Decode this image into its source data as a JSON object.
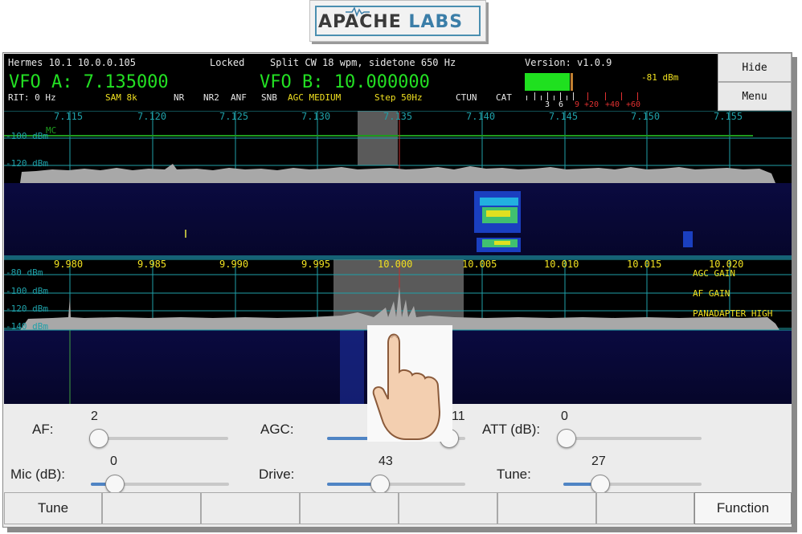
{
  "logo": {
    "text": "APACHE",
    "labs": "LABS"
  },
  "status": {
    "radio": "Hermes 10.1 10.0.0.105",
    "lock": "Locked",
    "mode": "Split CW 18 wpm, sidetone 650 Hz",
    "version": "Version: v1.0.9"
  },
  "vfo": {
    "a": "VFO A: 7.135000",
    "b": "VFO B: 10.000000"
  },
  "settings": {
    "rit": "RIT: 0 Hz",
    "mode": "SAM 8k",
    "nr": "NR",
    "nr2": "NR2",
    "anf": "ANF",
    "snb": "SNB",
    "agc": "AGC MEDIUM",
    "step": "Step 50Hz",
    "ctun": "CTUN",
    "cat": "CAT"
  },
  "meter": {
    "level_dbm": "-81 dBm",
    "scale_white": [
      "3",
      "6"
    ],
    "scale_red": [
      "9",
      "+20",
      "+40",
      "+60"
    ]
  },
  "side_buttons": {
    "hide": "Hide",
    "menu": "Menu"
  },
  "pan_a": {
    "freqs": [
      "7.115",
      "7.120",
      "7.125",
      "7.130",
      "7.135",
      "7.140",
      "7.145",
      "7.150",
      "7.155"
    ],
    "db_labels": [
      "-100 dBm",
      "-120 dBm"
    ],
    "marker": "MC"
  },
  "pan_b": {
    "freqs": [
      "9.980",
      "9.985",
      "9.990",
      "9.995",
      "10.000",
      "10.005",
      "10.010",
      "10.015",
      "10.020"
    ],
    "db_labels": [
      "-80 dBm",
      "-100 dBm",
      "-120 dBm",
      "-140 dBm"
    ],
    "overlay": [
      "AGC GAIN",
      "AF GAIN",
      "PANADAPTER HIGH"
    ]
  },
  "controls": {
    "af": {
      "label": "AF:",
      "value": "2",
      "fraction": 0.02
    },
    "agc": {
      "label": "AGC:",
      "value": "11",
      "fraction": 0.9
    },
    "att": {
      "label": "ATT (dB):",
      "value": "0",
      "fraction": 0.0
    },
    "mic": {
      "label": "Mic (dB):",
      "value": "0",
      "fraction": 0.16
    },
    "drive": {
      "label": "Drive:",
      "value": "43",
      "fraction": 0.43
    },
    "tune": {
      "label": "Tune:",
      "value": "27",
      "fraction": 0.27
    }
  },
  "bottom_buttons": [
    "Tune",
    "",
    "",
    "",
    "",
    "",
    "",
    "Function"
  ],
  "colors": {
    "grid": "#1fa0a8",
    "trace": "#a8a8a8",
    "green": "#23e023",
    "yellow": "#f0e020",
    "red": "#e03030"
  }
}
